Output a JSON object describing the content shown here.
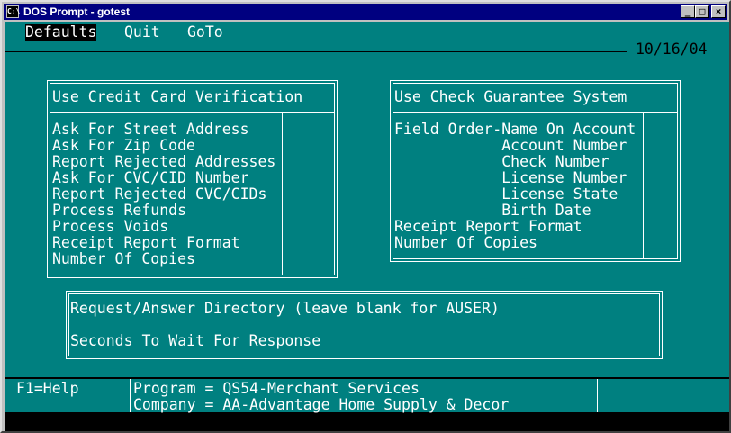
{
  "window": {
    "title": "DOS Prompt - gotest",
    "icon": "C:\\"
  },
  "window_controls": {
    "minimize": "_",
    "maximize": "□",
    "close": "×"
  },
  "menu": {
    "items": [
      "Defaults",
      "Quit",
      "GoTo"
    ],
    "date": "10/16/04"
  },
  "credit": {
    "title": "Use Credit Card Verification",
    "items": [
      "Ask For Street Address",
      "Ask For Zip Code",
      "Report Rejected Addresses",
      "Ask For CVC/CID Number",
      "Report Rejected CVC/CIDs",
      "Process Refunds",
      "Process Voids",
      "Receipt Report Format",
      "Number Of Copies"
    ]
  },
  "check": {
    "title": "Use Check Guarantee System",
    "items": [
      "Field Order-Name On Account",
      "            Account Number",
      "            Check Number",
      "            License Number",
      "            License State",
      "            Birth Date",
      "Receipt Report Format",
      "Number Of Copies"
    ]
  },
  "request": {
    "directory_label": "Request/Answer Directory (leave blank for AUSER)",
    "seconds_label": "Seconds To Wait For Response"
  },
  "status": {
    "help": "F1=Help",
    "program": "Program = QS54-Merchant Services",
    "company": "Company = AA-Advantage Home Supply & Decor"
  }
}
